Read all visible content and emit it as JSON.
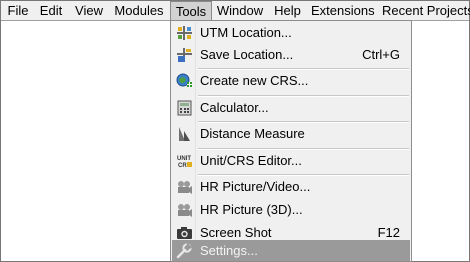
{
  "menubar": {
    "items": [
      "File",
      "Edit",
      "View",
      "Modules",
      "Tools",
      "Window",
      "Help",
      "Extensions",
      "Recent Projects"
    ],
    "active": "Tools"
  },
  "tools_menu": {
    "items": [
      {
        "label": "UTM Location...",
        "shortcut": "",
        "icon": "utm-location-icon"
      },
      {
        "label": "Save Location...",
        "shortcut": "Ctrl+G",
        "icon": "save-location-icon"
      },
      {
        "label": "Create new CRS...",
        "shortcut": "",
        "icon": "create-crs-icon"
      },
      {
        "label": "Calculator...",
        "shortcut": "",
        "icon": "calculator-icon"
      },
      {
        "label": "Distance Measure",
        "shortcut": "",
        "icon": "distance-measure-icon"
      },
      {
        "label": "Unit/CRS Editor...",
        "shortcut": "",
        "icon": "unit-crs-editor-icon"
      },
      {
        "label": "HR Picture/Video...",
        "shortcut": "",
        "icon": "hr-picture-video-icon"
      },
      {
        "label": "HR Picture (3D)...",
        "shortcut": "",
        "icon": "hr-picture-3d-icon"
      },
      {
        "label": "Screen Shot",
        "shortcut": "F12",
        "icon": "screenshot-icon"
      },
      {
        "label": "Settings...",
        "shortcut": "",
        "icon": "wrench-icon",
        "highlighted": true
      }
    ],
    "unit_icon_text": "UNIT\nCRS"
  },
  "colors": {
    "menubar_bg": "#f0f0f0",
    "menu_bg": "#f0f0f0",
    "highlight_bg": "#9a9a9a",
    "border": "#8d8d8d"
  }
}
